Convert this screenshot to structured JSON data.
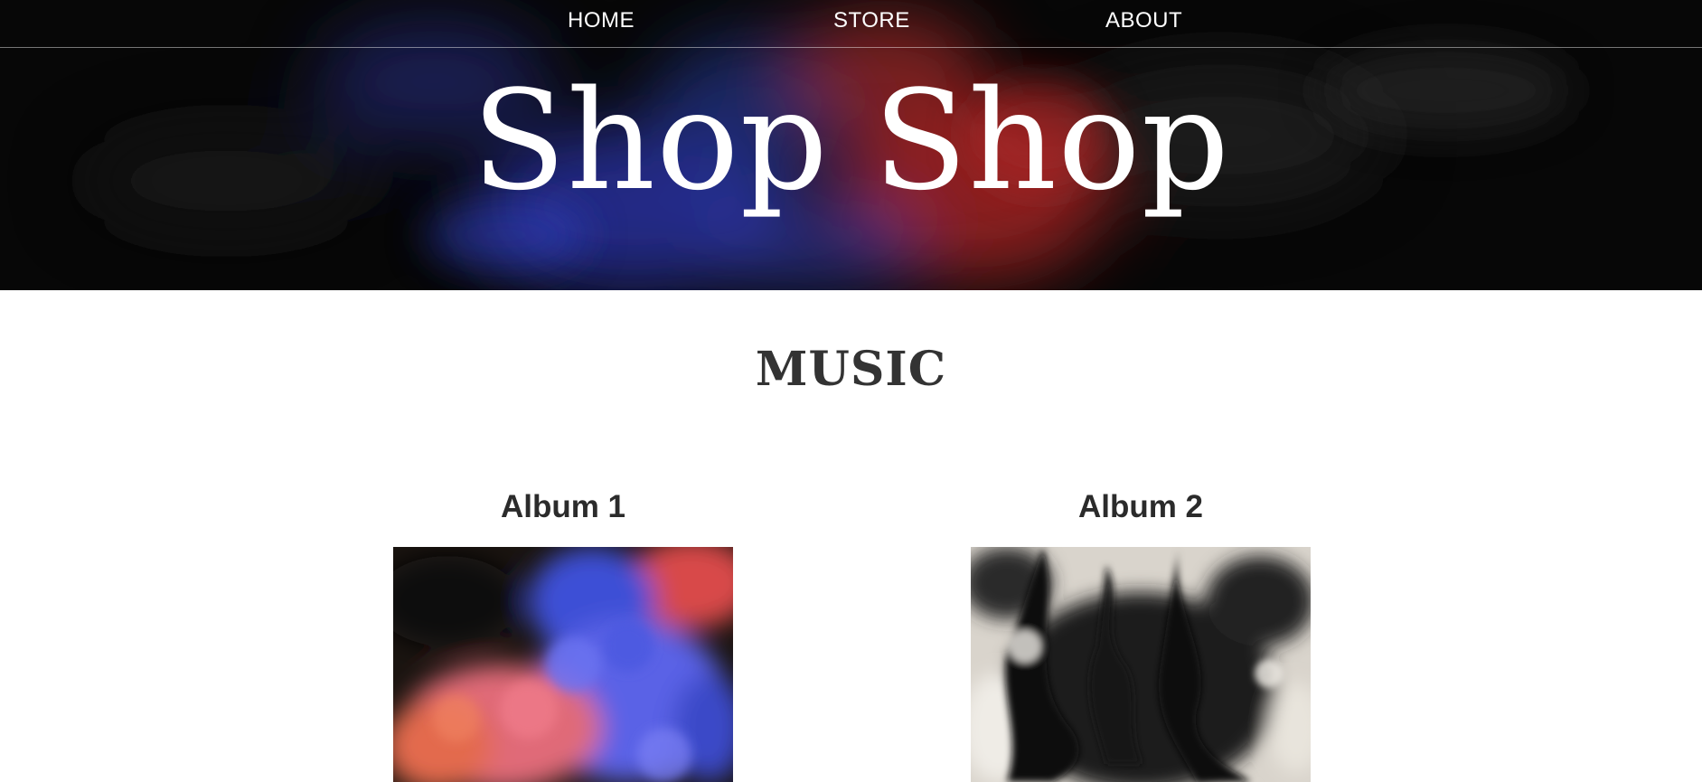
{
  "nav": {
    "items": [
      {
        "label": "HOME"
      },
      {
        "label": "STORE"
      },
      {
        "label": "ABOUT"
      }
    ]
  },
  "hero": {
    "title": "Shop Shop"
  },
  "section": {
    "title": "MUSIC"
  },
  "albums": [
    {
      "title": "Album 1"
    },
    {
      "title": "Album 2"
    }
  ],
  "colors": {
    "header_bg": "#060606",
    "nav_text": "#ffffff",
    "heading_text": "#333333",
    "page_bg": "#ffffff"
  }
}
